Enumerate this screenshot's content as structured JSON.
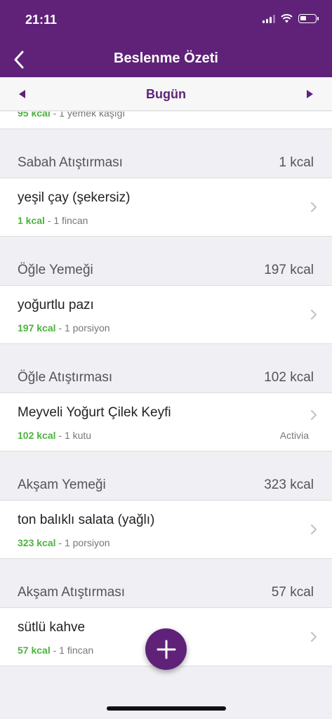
{
  "status_bar": {
    "time": "21:11"
  },
  "nav": {
    "title": "Beslenme Özeti"
  },
  "date_nav": {
    "label": "Bugün"
  },
  "partial_row": {
    "kcal": "95 kcal",
    "portion": " - 1 yemek kaşığı"
  },
  "sections": [
    {
      "title": "Sabah Atıştırması",
      "kcal": "1 kcal",
      "item": {
        "name": "yeşil çay (şekersiz)",
        "kcal": "1 kcal",
        "portion": " - 1 fincan",
        "brand": ""
      }
    },
    {
      "title": "Öğle Yemeği",
      "kcal": "197 kcal",
      "item": {
        "name": "yoğurtlu pazı",
        "kcal": "197 kcal",
        "portion": " - 1 porsiyon",
        "brand": ""
      }
    },
    {
      "title": "Öğle Atıştırması",
      "kcal": "102 kcal",
      "item": {
        "name": "Meyveli Yoğurt Çilek Keyfi",
        "kcal": "102 kcal",
        "portion": " - 1 kutu",
        "brand": "Activia"
      }
    },
    {
      "title": "Akşam Yemeği",
      "kcal": "323 kcal",
      "item": {
        "name": "ton balıklı salata (yağlı)",
        "kcal": "323 kcal",
        "portion": " - 1 porsiyon",
        "brand": ""
      }
    },
    {
      "title": "Akşam Atıştırması",
      "kcal": "57 kcal",
      "item": {
        "name": "sütlü kahve",
        "kcal": "57 kcal",
        "portion": " - 1 fincan",
        "brand": ""
      }
    }
  ],
  "colors": {
    "brand": "#5f2278",
    "kcal_green": "#4cb33d"
  },
  "icons": {
    "back": "chevron-left-icon",
    "prev": "triangle-left-icon",
    "next": "triangle-right-icon",
    "row": "chevron-right-icon",
    "fab": "plus-icon"
  }
}
